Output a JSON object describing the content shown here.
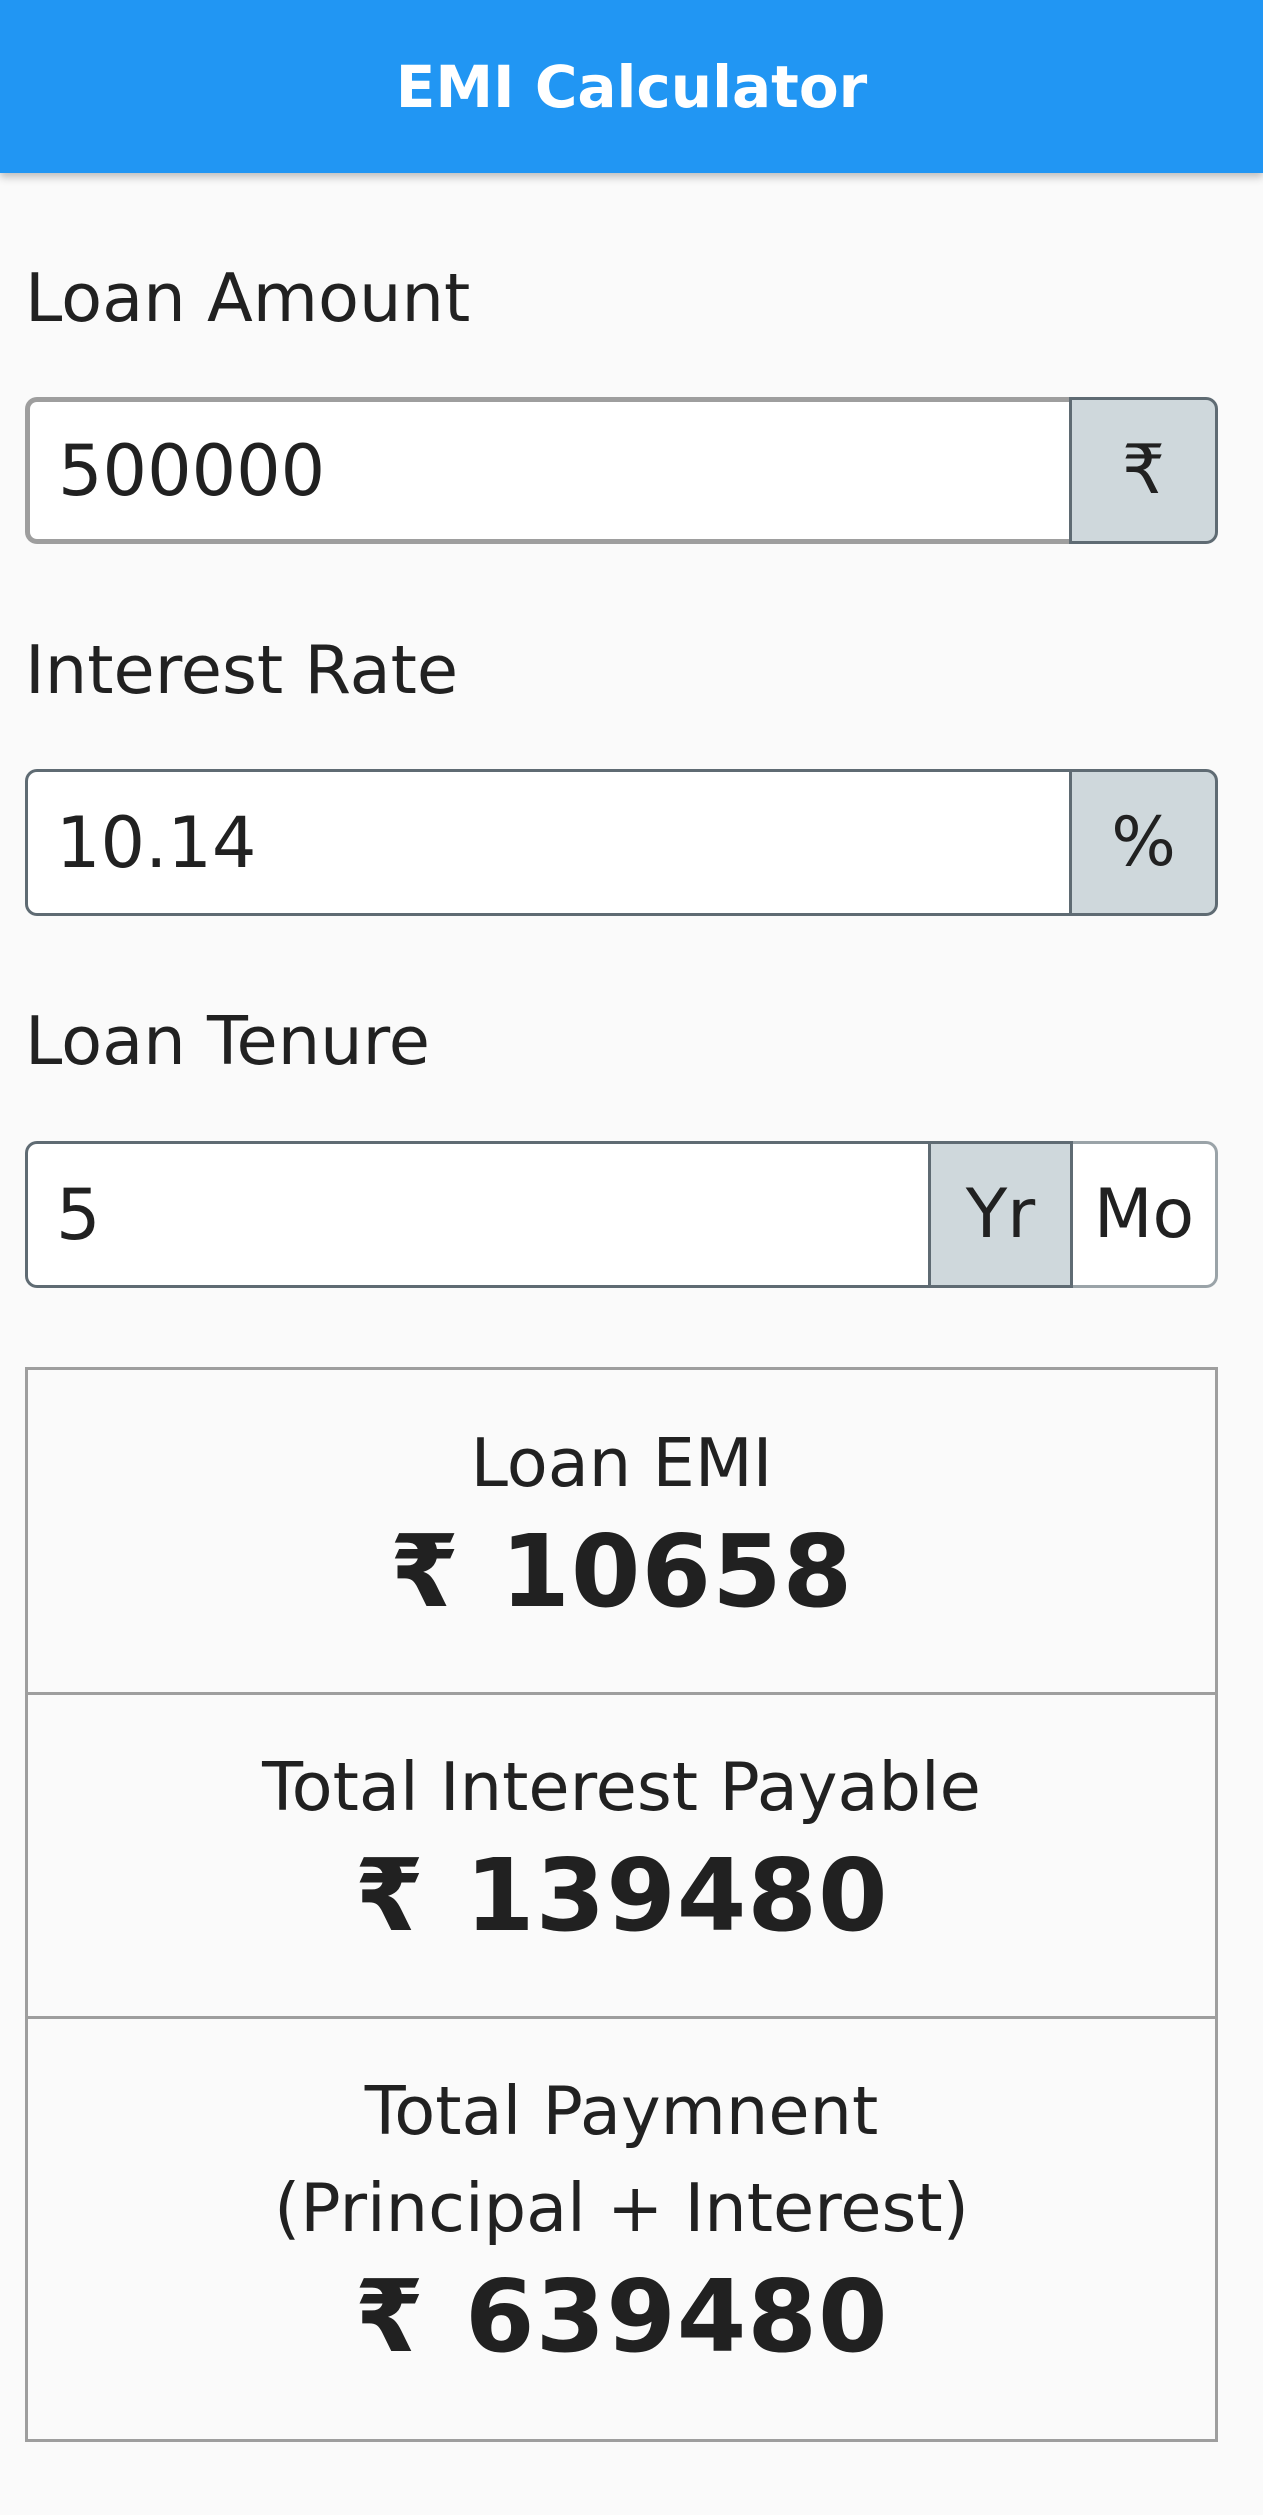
{
  "app_bar": {
    "title": "EMI Calculator",
    "color": "#2196f3"
  },
  "loan_amount": {
    "label": "Loan Amount",
    "value": "500000",
    "addon": "₹"
  },
  "interest_rate": {
    "label": "Interest Rate",
    "value": "10.14",
    "addon": "%"
  },
  "loan_tenure": {
    "label": "Loan Tenure",
    "value": "5",
    "unit_year": "Yr",
    "unit_month": "Mo",
    "selected_unit": "Yr"
  },
  "results": {
    "emi": {
      "label": "Loan EMI",
      "currency": "₹",
      "value": "10658"
    },
    "total_interest": {
      "label": "Total Interest Payable",
      "currency": "₹",
      "value": "139480"
    },
    "total_payment": {
      "label_line1": "Total Paymnent",
      "label_line2": "(Principal + Interest)",
      "currency": "₹",
      "value": "639480"
    }
  }
}
